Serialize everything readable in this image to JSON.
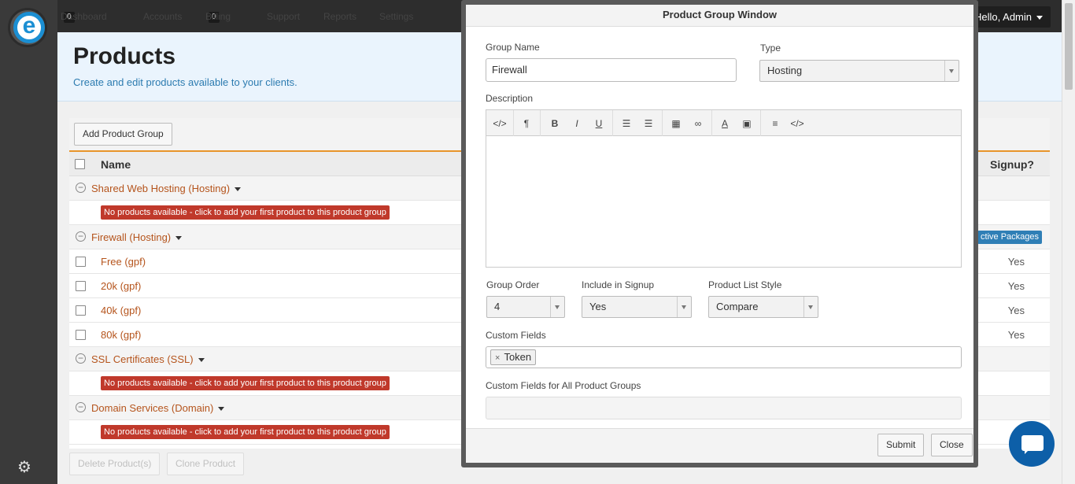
{
  "nav": {
    "items": [
      {
        "label": "Dashboard",
        "count": "0"
      },
      {
        "label": "Accounts"
      },
      {
        "label": "Billing",
        "count": "0"
      },
      {
        "label": "Support"
      },
      {
        "label": "Reports"
      },
      {
        "label": "Settings",
        "active": true
      }
    ],
    "user": "Hello, Admin"
  },
  "page": {
    "title": "Products",
    "subtitle": "Create and edit products available to your clients."
  },
  "toolbar": {
    "add_group": "Add Product Group",
    "delete": "Delete Product(s)",
    "clone": "Clone Product"
  },
  "table": {
    "col_name": "Name",
    "col_signup": "Signup?",
    "empty_msg": "No products available - click to add your first product to this product group",
    "packages_badge": "ctive Packages",
    "groups": [
      {
        "name": "Shared Web Hosting (Hosting)",
        "products": []
      },
      {
        "name": "Firewall (Hosting)",
        "products": [
          {
            "name": "Free (gpf)",
            "signup": "Yes"
          },
          {
            "name": "20k (gpf)",
            "signup": "Yes"
          },
          {
            "name": "40k (gpf)",
            "signup": "Yes"
          },
          {
            "name": "80k (gpf)",
            "signup": "Yes"
          }
        ]
      },
      {
        "name": "SSL Certificates (SSL)",
        "products": []
      },
      {
        "name": "Domain Services (Domain)",
        "products": []
      }
    ]
  },
  "modal": {
    "title": "Product Group Window",
    "group_name_label": "Group Name",
    "group_name_value": "Firewall",
    "type_label": "Type",
    "type_value": "Hosting",
    "description_label": "Description",
    "group_order_label": "Group Order",
    "group_order_value": "4",
    "include_signup_label": "Include in Signup",
    "include_signup_value": "Yes",
    "list_style_label": "Product List Style",
    "list_style_value": "Compare",
    "custom_fields_label": "Custom Fields",
    "custom_fields_tag": "Token",
    "custom_fields_all_label": "Custom Fields for All Product Groups",
    "submit": "Submit",
    "close": "Close"
  },
  "editor_tools": [
    "code-view",
    "paragraph",
    "bold",
    "italic",
    "underline",
    "bullet-list",
    "numbered-list",
    "table",
    "link",
    "font-color",
    "highlight",
    "align",
    "source"
  ],
  "icons": {
    "logo": "e",
    "gear": "⚙",
    "minus": "−",
    "tag_remove": "×"
  },
  "colors": {
    "accent_orange": "#e8952b",
    "link_red": "#b5541c",
    "error_red": "#c0392b",
    "nav_bg": "#2d2d2d",
    "info_blue": "#2f7fb6"
  }
}
